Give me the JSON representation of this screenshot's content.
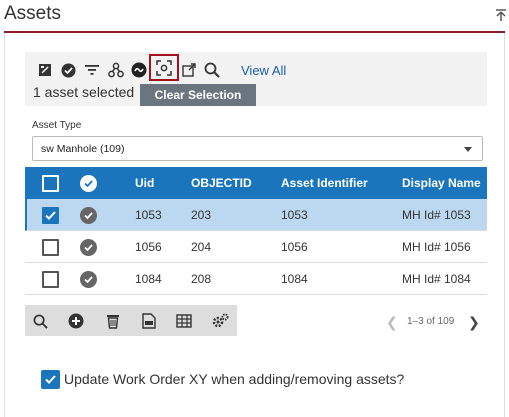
{
  "panel": {
    "title": "Assets",
    "accent": "#8b1a2b"
  },
  "toolbar": {
    "buttons": [
      "bulk-edit-icon",
      "check-circle-icon",
      "filter-icon",
      "network-trace-icon",
      "link-icon",
      "clear-selection-icon",
      "open-external-icon",
      "search-icon"
    ],
    "view_all": "View All",
    "selected_count": "1 asset selected",
    "tooltip": "Clear Selection"
  },
  "asset_type": {
    "label": "Asset Type",
    "value": "sw Manhole (109)"
  },
  "grid": {
    "columns": [
      "Uid",
      "OBJECTID",
      "Asset Identifier",
      "Display Name"
    ],
    "header_color": "#1b75bc",
    "rows": [
      {
        "uid": "1053",
        "objectid": "203",
        "identifier": "1053",
        "display": "MH Id# 1053",
        "selected": true
      },
      {
        "uid": "1056",
        "objectid": "204",
        "identifier": "1056",
        "display": "MH Id# 1056",
        "selected": false
      },
      {
        "uid": "1084",
        "objectid": "208",
        "identifier": "1084",
        "display": "MH Id# 1084",
        "selected": false
      }
    ]
  },
  "footer": {
    "buttons": [
      "search-icon",
      "add-icon",
      "delete-icon",
      "export-icon",
      "table-icon",
      "settings-icon"
    ],
    "pager": "1–3 of 109"
  },
  "update_xy": {
    "label": "Update Work Order XY when adding/removing assets?",
    "checked": true
  }
}
